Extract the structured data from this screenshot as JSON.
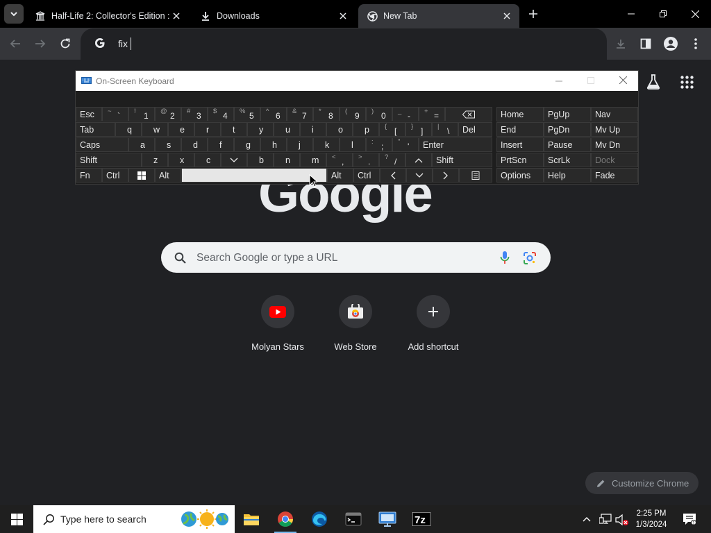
{
  "browser": {
    "tabs": [
      {
        "title": "Half-Life 2: Collector's Edition : ",
        "icon": "library-icon",
        "active": false
      },
      {
        "title": "Downloads",
        "icon": "download-icon",
        "active": false
      },
      {
        "title": "New Tab",
        "icon": "chrome-icon",
        "active": true
      }
    ],
    "omnibox": {
      "value": "fix",
      "icon": "google-g-icon"
    }
  },
  "page": {
    "logo": "Google",
    "search": {
      "placeholder": "Search Google or type a URL"
    },
    "shortcuts": [
      {
        "label": "Molyan Stars",
        "icon": "youtube-icon"
      },
      {
        "label": "Web Store",
        "icon": "web-store-icon"
      },
      {
        "label": "Add shortcut",
        "icon": "plus-icon"
      }
    ],
    "customize_label": "Customize Chrome"
  },
  "osk": {
    "title": "On-Screen Keyboard",
    "rows": [
      [
        "Esc",
        "~ `",
        "! 1",
        "@ 2",
        "# 3",
        "$ 4",
        "% 5",
        "^ 6",
        "& 7",
        "* 8",
        "( 9",
        ") 0",
        "_ -",
        "+ =",
        "⌫"
      ],
      [
        "Tab",
        "q",
        "w",
        "e",
        "r",
        "t",
        "y",
        "u",
        "i",
        "o",
        "p",
        "{ [",
        "} ]",
        "| \\",
        "Del"
      ],
      [
        "Caps",
        "a",
        "s",
        "d",
        "f",
        "g",
        "h",
        "j",
        "k",
        "l",
        ": ;",
        "\" '",
        "Enter"
      ],
      [
        "Shift",
        "z",
        "x",
        "c",
        "v",
        "b",
        "n",
        "m",
        "< ,",
        "> .",
        "? /",
        "^",
        "Shift"
      ],
      [
        "Fn",
        "Ctrl",
        "win",
        "Alt",
        "",
        "Alt",
        "Ctrl",
        "<",
        "v",
        ">",
        "menu"
      ]
    ],
    "nav_keys": [
      [
        "Home",
        "PgUp",
        "Nav"
      ],
      [
        "End",
        "PgDn",
        "Mv Up"
      ],
      [
        "Insert",
        "Pause",
        "Mv Dn"
      ],
      [
        "PrtScn",
        "ScrLk",
        "Dock"
      ],
      [
        "Options",
        "Help",
        "Fade"
      ]
    ]
  },
  "taskbar": {
    "search_placeholder": "Type here to search",
    "time": "2:25 PM",
    "date": "1/3/2024"
  },
  "colors": {
    "accent": "#8ab4f8",
    "page_bg": "#202124",
    "toolbar_bg": "#35363a"
  }
}
